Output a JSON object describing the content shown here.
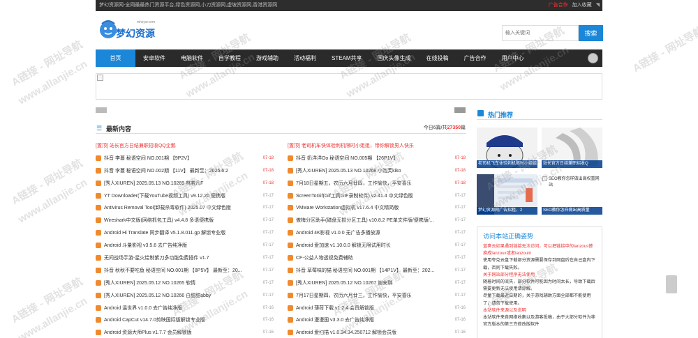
{
  "topbar": {
    "slogan": "梦幻资源网-全网最最热门资源平台,绿色资源网,小刀资源网,虚坡资源网,香港资源网",
    "ad_link": "广告合作",
    "fav_link": "加入收藏",
    "rss_icon": "rss-icon"
  },
  "logo": {
    "text": "梦幻资源",
    "sub": "mhzyw.com"
  },
  "search": {
    "placeholder": "输入关键词",
    "button": "搜索"
  },
  "nav": {
    "items": [
      "首页",
      "安卓软件",
      "电脑软件",
      "自学教程",
      "游戏辅助",
      "活动福利",
      "STEAM共享",
      "国庆头像生成",
      "在线投稿",
      "广告合作",
      "用户中心"
    ]
  },
  "section": {
    "title": "最新内容",
    "stats_prefix": "今日6篇/共",
    "stats_total": "27350",
    "stats_suffix": "篇"
  },
  "left_list": [
    {
      "text": "[置顶] 站长官方日结兼职招收QQ企鹅",
      "date": "",
      "top": true
    },
    {
      "text": "抖音 李蔓 秘语空间 NO.001期 【9P2V】",
      "date": "07-18",
      "red": true
    },
    {
      "text": "抖音 李蔓 秘语空间 NO.002期 【11V】 最新至：2025.6.2",
      "date": "07-18",
      "red": true
    },
    {
      "text": "[秀人XIUREN] 2025.05.13 NO.10269 林若凡F",
      "date": "07-18",
      "red": true
    },
    {
      "text": "YT Downloader(下载YouTube视频工具) v9.12.20 便携版",
      "date": "07-17"
    },
    {
      "text": "Antivirus Removal Tool(卸载杀毒软件) 2025.07 中文绿色版",
      "date": "07-17"
    },
    {
      "text": "Wireshark中文版(网络抓包工具) v4.4.8 多语便携版",
      "date": "07-17"
    },
    {
      "text": "Android Hi Translate 同步翻译 v5.1.8.011.gp 解锁专业版",
      "date": "07-17"
    },
    {
      "text": "Android 斗量影视 v3.5.6 去广告纯净版",
      "date": "07-17"
    },
    {
      "text": "无间战场手游-星火绘制紫刀多功能免费插件 v1.7",
      "date": "07-17"
    },
    {
      "text": "抖音 秋秋不要吃鱼 秘语空间 NO.001期 【8P5V】 最新至：20...",
      "date": "07-17"
    },
    {
      "text": "[秀人XIUREN] 2025.05.12 NO.10265 软情",
      "date": "07-17"
    },
    {
      "text": "[秀人XIUREN] 2025.05.12 NO.10266 白甜甜abby",
      "date": "07-17"
    },
    {
      "text": "Android 温世界 v1.0.0 去广告纯净版",
      "date": "07-16"
    },
    {
      "text": "Android CapCut v14.7.0剪映国际版解锁专业版",
      "date": "07-16"
    },
    {
      "text": "Android 资源大师Plus v1.7.7 会员解锁版",
      "date": "07-16"
    }
  ],
  "right_list": [
    {
      "text": "[置顶] 老司机车快体验刺机限时小姐姐，带你解锁男人快乐",
      "date": "",
      "top": true
    },
    {
      "text": "抖音 奶洋洋Oo 秘语空间 NO.005期 【26P1V】",
      "date": "07-18",
      "red": true
    },
    {
      "text": "[秀人XIUREN] 2025.05.13 NO.10268 小泡芙kiko",
      "date": "07-18",
      "red": true
    },
    {
      "text": "7月18日星期五，农历六月廿四，工作愉快，平安喜乐",
      "date": "07-18",
      "red": true
    },
    {
      "text": "ScreenToGif(Gif工具GIF录制软件) v2.41.4 中文绿色版",
      "date": "07-17"
    },
    {
      "text": "VMware Workstation虚拟机 v17.6.4 中文精简版",
      "date": "07-17"
    },
    {
      "text": "傲梅分区助手(磁盘无损分区工具) v10.8.2 PE单文件版/便携版/...",
      "date": "07-17"
    },
    {
      "text": "Android 4K影视 v1.0.0 无广告多播放源",
      "date": "07-17"
    },
    {
      "text": "Android 爱加速 v1.10.0.0 解锁无限试用时长",
      "date": "07-17"
    },
    {
      "text": "CF-公益人物透视免费辅助",
      "date": "07-17"
    },
    {
      "text": "抖音 草莓味的猫 秘语空间 NO.001期 【14P1V】 最新至：202...",
      "date": "07-17"
    },
    {
      "text": "[秀人XIUREN] 2025.05.12 NO.10267 谢安琪",
      "date": "07-17"
    },
    {
      "text": "7月17日星期四，农历六月廿三，工作愉快，平安喜乐",
      "date": "07-17"
    },
    {
      "text": "Android 薄荷下载 v1.2.4 会员解锁版",
      "date": "07-16"
    },
    {
      "text": "Android 漫漫国 v3.3.0 去广告纯净版",
      "date": "07-16"
    },
    {
      "text": "Android 爱扫描 v1.0.34.34.250712 解锁会员版",
      "date": "07-16"
    }
  ],
  "hot": {
    "title": "热门推荐",
    "tiles": [
      {
        "caption": "老司机飞车体验刺机限时小姐姐"
      },
      {
        "caption": "站长官方日结兼职招收Q"
      },
      {
        "caption": "梦幻资源网广告招租，2"
      },
      {
        "caption": "SEO教你怎样做出高质量",
        "alt": "SEO教你怎样做出高权重网站"
      }
    ]
  },
  "notice": {
    "title": "访问本站正确姿势",
    "lines": [
      {
        "text": "蓝奏云如果遇到链接无法访问，可以把链接中的lanzous替换成lanzoux或者lanzoum",
        "red": true
      },
      {
        "text": "使用夸克云盘下载部分资源需要保存到网盘后在自己盘内下载，否则下载失败。",
        "red": false
      },
      {
        "text": "关于网站部分程序无法使用",
        "red": true
      },
      {
        "text": "随着时间的流失，部分软件可能因为时间太长，导致下载后需要更新无法使用请谅解。",
        "red": false
      },
      {
        "text": "尽量下载最近日期的，关于游戏辅助方面全部都不能使用了，请勿下载使用。",
        "red": false
      },
      {
        "text": "本站软件来源以及说明",
        "red": true
      },
      {
        "text": "本站软件来自网络收集以及游客投稿，由于大部分软件为非官方版本的第三方修改版软件",
        "red": false
      }
    ]
  },
  "watermark": {
    "text1": "A链接 - 网址导航",
    "text2": "www.allanjie.cn"
  }
}
